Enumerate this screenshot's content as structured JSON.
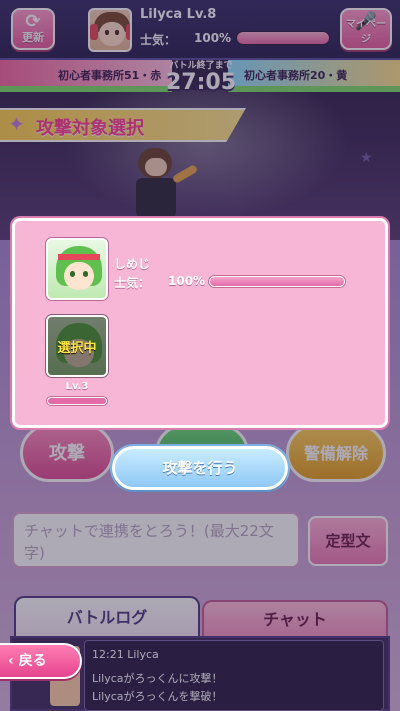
{
  "header": {
    "refresh_label": "更新",
    "player_name": "Lilyca Lv.8",
    "morale_label": "士気：",
    "morale_value": "100%",
    "morale_fraction": 1.0,
    "mypage_label": "マイページ"
  },
  "battle": {
    "timer_caption": "バトル終了まで",
    "timer": "27:05",
    "agency_left": "初心者事務所51・赤",
    "agency_right": "初心者事務所20・黄"
  },
  "banner": {
    "title": "攻撃対象選択"
  },
  "modal": {
    "target": {
      "name": "しめじ",
      "morale_label": "士気：",
      "morale_value": "100%",
      "morale_fraction": 1.0
    },
    "selected": {
      "badge": "選択中",
      "level": "Lv.3",
      "level_fraction": 1.0
    },
    "attack_button": "攻撃を行う"
  },
  "actions": {
    "attack": "攻撃",
    "guard_release": "警備解除"
  },
  "chat": {
    "placeholder": "チャットで連携をとろう！(最大22文字)",
    "template_button": "定型文"
  },
  "tabs": {
    "battle_log": "バトルログ",
    "chat": "チャット"
  },
  "log": {
    "time_user": "12:21  Lilyca",
    "line1": "Lilycaがろっくんに攻撃！",
    "line2": "Lilycaがろっくんを撃破！"
  },
  "nav": {
    "back": "戻る"
  },
  "colors": {
    "accent_pink": "#e9609f",
    "modal_bg": "#f7b6d6",
    "banner_yellow": "#ffd44f",
    "highlight_yellow": "#ffe53f"
  }
}
